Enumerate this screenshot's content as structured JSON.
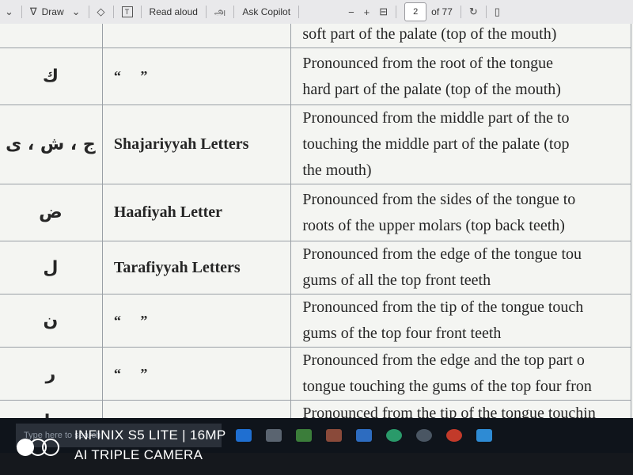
{
  "toolbar": {
    "draw_label": "Draw",
    "read_aloud_label": "Read aloud",
    "ask_copilot_label": "Ask Copilot",
    "page_current": "2",
    "page_total": "of 77"
  },
  "table": {
    "top_partial_desc": "soft part of the palate (top of the mouth)",
    "rows": [
      {
        "letters": "ك",
        "name": "“  ”",
        "desc": [
          "Pronounced from the root of the tongue",
          "hard part of the palate (top of the mouth)"
        ]
      },
      {
        "letters": "ج ، ش ، ى",
        "name": "Shajariyyah Letters",
        "desc": [
          "Pronounced from the middle part of the to",
          "touching the middle part of the palate (top",
          "the mouth)"
        ]
      },
      {
        "letters": "ض",
        "name": "Haafiyah Letter",
        "desc": [
          "Pronounced from the sides of the tongue to",
          "roots of the upper molars (top back teeth)"
        ]
      },
      {
        "letters": "ل",
        "name": "Tarafiyyah Letters",
        "desc": [
          "Pronounced from the edge of the tongue tou",
          "gums of all the top front teeth"
        ]
      },
      {
        "letters": "ن",
        "name": "“  ”",
        "desc": [
          "Pronounced from the tip of the tongue touch",
          "gums of the top four front teeth"
        ]
      },
      {
        "letters": "ر",
        "name": "“  ”",
        "desc": [
          "Pronounced from the edge and the top part o",
          "tongue touching the gums of the top four fron"
        ]
      },
      {
        "letters": "ط",
        "name": "",
        "desc": [
          "Pronounced from the tip of the tongue touchin"
        ]
      }
    ]
  },
  "taskbar": {
    "search_placeholder": "Type here to search"
  },
  "watermark": {
    "line1": "INFINIX S5 LITE | 16MP",
    "line2": "AI TRIPLE CAMERA"
  },
  "colors": {
    "page_bg": "#f4f5f2",
    "table_border": "#9aa0a6",
    "toolbar_bg": "#e9e9eb",
    "taskbar_bg": "#0f141b"
  }
}
